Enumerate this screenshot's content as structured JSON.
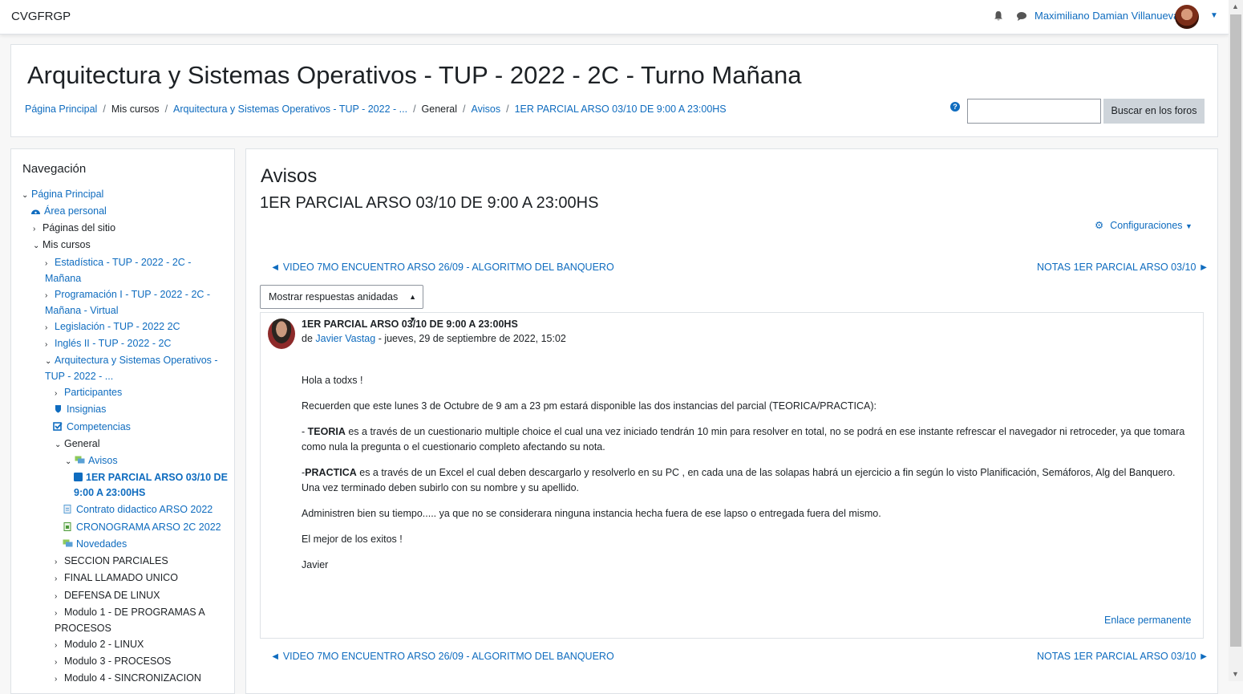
{
  "navbar": {
    "brand": "CVGFRGP",
    "user_name": "Maximiliano Damian Villanueva"
  },
  "header": {
    "title": "Arquitectura y Sistemas Operativos - TUP - 2022 - 2C - Turno Mañana",
    "breadcrumb": [
      "Página Principal",
      "Mis cursos",
      "Arquitectura y Sistemas Operativos - TUP - 2022 - ...",
      "General",
      "Avisos",
      "1ER PARCIAL ARSO 03/10 DE 9:00 A 23:00HS"
    ],
    "search_button": "Buscar en los foros"
  },
  "nav": {
    "heading": "Navegación",
    "items": [
      "Página Principal",
      "Área personal",
      "Páginas del sitio",
      "Mis cursos",
      "Estadística - TUP - 2022 - 2C - Mañana",
      "Programación I - TUP - 2022 - 2C - Mañana - Virtual",
      "Legislación - TUP - 2022 2C",
      "Inglés II - TUP - 2022 - 2C",
      "Arquitectura y Sistemas Operativos - TUP - 2022 - ...",
      "Participantes",
      "Insignias",
      "Competencias",
      "General",
      "Avisos",
      "1ER PARCIAL ARSO 03/10 DE 9:00 A 23:00HS",
      "Contrato didactico ARSO 2022",
      "CRONOGRAMA ARSO 2C 2022",
      "Novedades",
      "SECCION PARCIALES",
      "FINAL LLAMADO UNICO",
      "DEFENSA DE LINUX",
      "Modulo 1 - DE PROGRAMAS A PROCESOS",
      "Modulo 2 - LINUX",
      "Modulo 3 - PROCESOS",
      "Modulo 4 - SINCRONIZACION"
    ]
  },
  "main": {
    "forum_title": "Avisos",
    "discussion_title": "1ER PARCIAL ARSO 03/10 DE 9:00 A 23:00HS",
    "config_label": "Configuraciones",
    "prev_discussion": "◄ VIDEO 7MO ENCUENTRO ARSO 26/09 - ALGORITMO DEL BANQUERO",
    "next_discussion": "NOTAS 1ER PARCIAL ARSO 03/10 ►",
    "display_mode": "Mostrar respuestas anidadas",
    "post": {
      "subject": "1ER PARCIAL ARSO 03/10 DE 9:00 A 23:00HS",
      "by_prefix": "de",
      "author": "Javier Vastag",
      "date": "- jueves, 29 de septiembre de 2022, 15:02",
      "p1": "Hola a todxs !",
      "p2": "Recuerden que este lunes 3 de Octubre de 9 am a 23 pm estará disponible las dos instancias del parcial (TEORICA/PRACTICA):",
      "p3_prefix": "- ",
      "p3_bold": "TEORIA",
      "p3_rest": " es a través de un cuestionario multiple choice el cual una vez iniciado tendrán 10 min para resolver en total, no se podrá en ese instante refrescar el navegador ni retroceder, ya que tomara como nula la pregunta o el cuestionario completo afectando su nota.",
      "p4_prefix": "-",
      "p4_bold": "PRACTICA",
      "p4_rest": " es a través de un Excel el cual deben descargarlo y resolverlo en su PC , en cada una de las solapas habrá un ejercicio a fin según lo visto Planificación, Semáforos, Alg del Banquero. Una vez terminado deben subirlo con su nombre y su apellido.",
      "p5": "Administren bien su tiempo..... ya que no se considerara ninguna instancia hecha fuera de ese lapso o entregada fuera del mismo.",
      "p6": "El mejor de los exitos !",
      "p7": "Javier",
      "permalink": "Enlace permanente"
    }
  }
}
